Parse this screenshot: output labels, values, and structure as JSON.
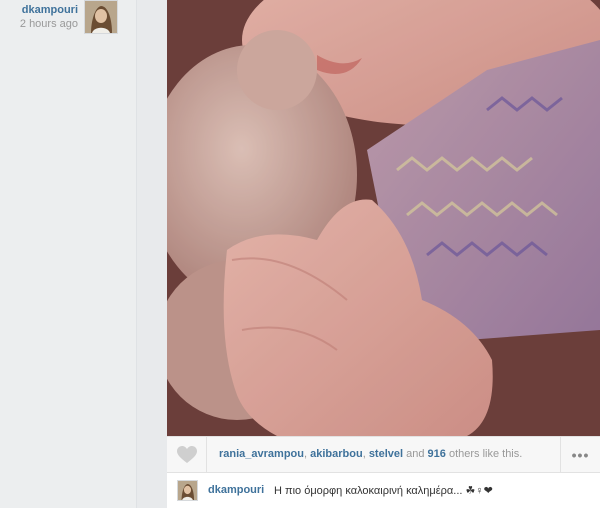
{
  "post": {
    "author": "dkampouri",
    "time": "2 hours ago",
    "photo_description_icon": "photo",
    "likes": {
      "likers": [
        "rania_avrampou",
        "akibarbou",
        "stelvel"
      ],
      "separator": ", ",
      "and_text": " and ",
      "count": "916",
      "suffix": " others like this."
    },
    "more_label": "•••",
    "caption": {
      "author": "dkampouri",
      "text": "Η πιο όμορφη καλοκαιρινή καλημέρα... ☘♀❤"
    }
  },
  "colors": {
    "link": "#3f729b",
    "muted": "#999999",
    "panel": "#eceeef"
  }
}
